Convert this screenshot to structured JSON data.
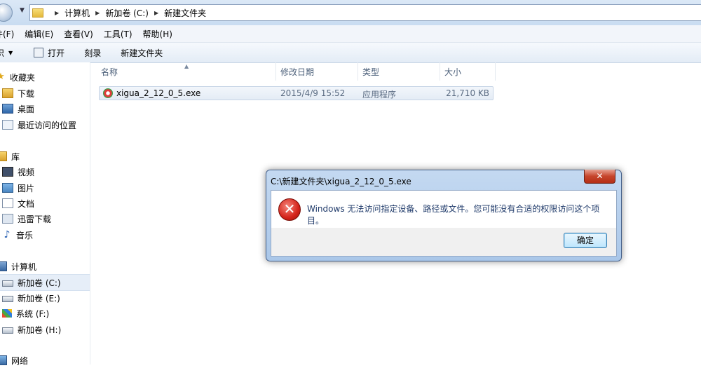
{
  "address_bar": {
    "breadcrumbs": [
      "计算机",
      "新加卷 (C:)",
      "新建文件夹"
    ]
  },
  "menu": {
    "items": [
      "件(F)",
      "编辑(E)",
      "查看(V)",
      "工具(T)",
      "帮助(H)"
    ]
  },
  "toolbar": {
    "organize": "织",
    "open": "打开",
    "burn": "刻录",
    "new_folder": "新建文件夹"
  },
  "sidebar": {
    "favorites": "收藏夹",
    "downloads": "下载",
    "desktop": "桌面",
    "recent": "最近访问的位置",
    "libraries": "库",
    "videos": "视频",
    "pictures": "图片",
    "documents": "文档",
    "xunlei": "迅雷下载",
    "music": "音乐",
    "computer": "计算机",
    "drive_c": "新加卷 (C:)",
    "drive_e": "新加卷 (E:)",
    "drive_f": "系统 (F:)",
    "drive_h": "新加卷 (H:)",
    "network": "网络"
  },
  "columns": {
    "name": "名称",
    "date": "修改日期",
    "type": "类型",
    "size": "大小"
  },
  "files": [
    {
      "name": "xigua_2_12_0_5.exe",
      "date": "2015/4/9 15:52",
      "type": "应用程序",
      "size": "21,710 KB"
    }
  ],
  "dialog": {
    "title": "C:\\新建文件夹\\xigua_2_12_0_5.exe",
    "message": "Windows 无法访问指定设备、路径或文件。您可能没有合适的权限访问这个项目。",
    "ok": "确定",
    "close_glyph": "✕",
    "error_glyph": "✕"
  },
  "colors": {
    "selection": "#e6eef8",
    "dialog_frame": "#aac7e9",
    "error_red": "#d4231a",
    "close_red": "#c6442b"
  }
}
